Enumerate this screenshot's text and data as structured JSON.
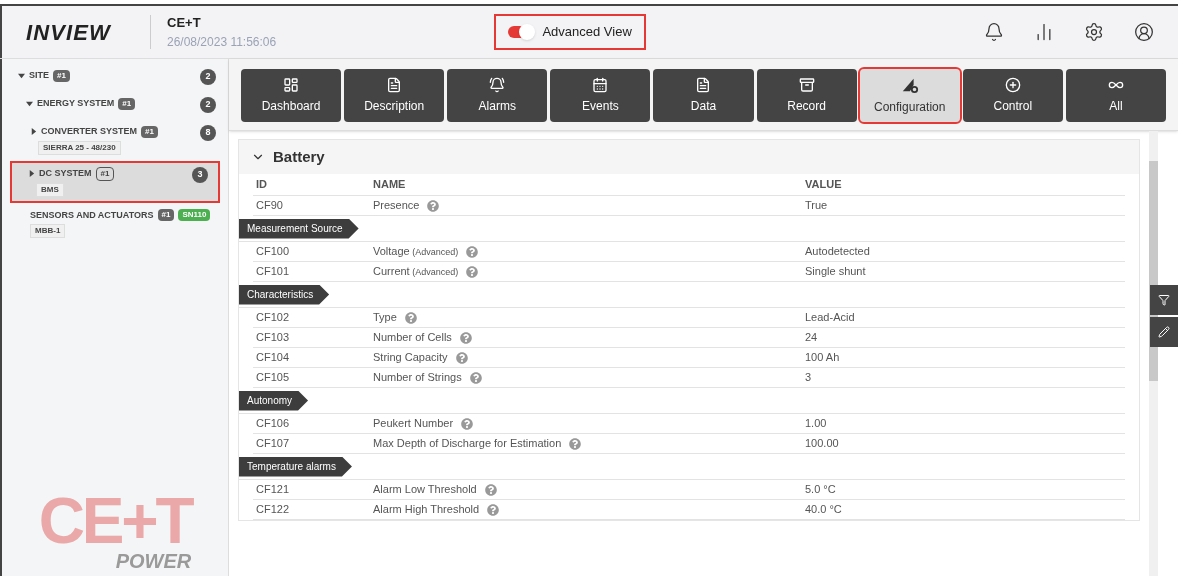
{
  "header": {
    "logo": "INVIEW",
    "site_name": "CE+T",
    "timestamp": "26/08/2023 11:56:06",
    "advanced_view": {
      "label": "Advanced View",
      "on": true,
      "highlighted": true
    }
  },
  "sidebar": {
    "tree": [
      {
        "label": "SITE",
        "tag": "#1",
        "count": "2",
        "expanded": true,
        "selected": false,
        "highlighted": false,
        "children": [
          {
            "label": "ENERGY SYSTEM",
            "tag": "#1",
            "count": "2",
            "expanded": true,
            "selected": false,
            "highlighted": false,
            "children": [
              {
                "label": "CONVERTER SYSTEM",
                "tag": "#1",
                "subtitle": "SIERRA 25 - 48/230",
                "count": "8",
                "expanded": false,
                "selected": false,
                "highlighted": false
              },
              {
                "label": "DC SYSTEM",
                "tag": "#1",
                "subtitle": "BMS",
                "count": "3",
                "expanded": false,
                "selected": true,
                "highlighted": true
              },
              {
                "label": "SENSORS AND ACTUATORS",
                "tag": "#1",
                "badge": {
                  "text": "SN110",
                  "color": "#4caf50"
                },
                "subtitle": "MBB-1",
                "selected": false,
                "highlighted": false
              }
            ]
          }
        ]
      }
    ],
    "brand": {
      "mark": "CE+T",
      "word": "POWER"
    }
  },
  "tabs": [
    {
      "label": "Dashboard",
      "selected": false,
      "highlighted": false
    },
    {
      "label": "Description",
      "selected": false,
      "highlighted": false
    },
    {
      "label": "Alarms",
      "selected": false,
      "highlighted": false
    },
    {
      "label": "Events",
      "selected": false,
      "highlighted": false
    },
    {
      "label": "Data",
      "selected": false,
      "highlighted": false
    },
    {
      "label": "Record",
      "selected": false,
      "highlighted": false
    },
    {
      "label": "Configuration",
      "selected": true,
      "highlighted": true
    },
    {
      "label": "Control",
      "selected": false,
      "highlighted": false
    },
    {
      "label": "All",
      "selected": false,
      "highlighted": false
    }
  ],
  "panel": {
    "title": "Battery",
    "expanded": true,
    "columns": [
      "ID",
      "NAME",
      "VALUE"
    ],
    "rows": [
      {
        "kind": "row",
        "id": "CF90",
        "name": "Presence",
        "value": "True"
      },
      {
        "kind": "section",
        "label": "Measurement Source"
      },
      {
        "kind": "row",
        "id": "CF100",
        "name": "Voltage",
        "note": "(Advanced)",
        "value": "Autodetected"
      },
      {
        "kind": "row",
        "id": "CF101",
        "name": "Current",
        "note": "(Advanced)",
        "value": "Single shunt"
      },
      {
        "kind": "section",
        "label": "Characteristics"
      },
      {
        "kind": "row",
        "id": "CF102",
        "name": "Type",
        "value": "Lead-Acid"
      },
      {
        "kind": "row",
        "id": "CF103",
        "name": "Number of Cells",
        "value": "24"
      },
      {
        "kind": "row",
        "id": "CF104",
        "name": "String Capacity",
        "value": "100 Ah"
      },
      {
        "kind": "row",
        "id": "CF105",
        "name": "Number of Strings",
        "value": "3"
      },
      {
        "kind": "section",
        "label": "Autonomy"
      },
      {
        "kind": "row",
        "id": "CF106",
        "name": "Peukert Number",
        "value": "1.00"
      },
      {
        "kind": "row",
        "id": "CF107",
        "name": "Max Depth of Discharge for Estimation",
        "value": "100.00"
      },
      {
        "kind": "section",
        "label": "Temperature alarms"
      },
      {
        "kind": "row",
        "id": "CF121",
        "name": "Alarm Low Threshold",
        "value": "5.0 °C"
      },
      {
        "kind": "row",
        "id": "CF122",
        "name": "Alarm High Threshold",
        "value": "40.0 °C"
      }
    ]
  }
}
